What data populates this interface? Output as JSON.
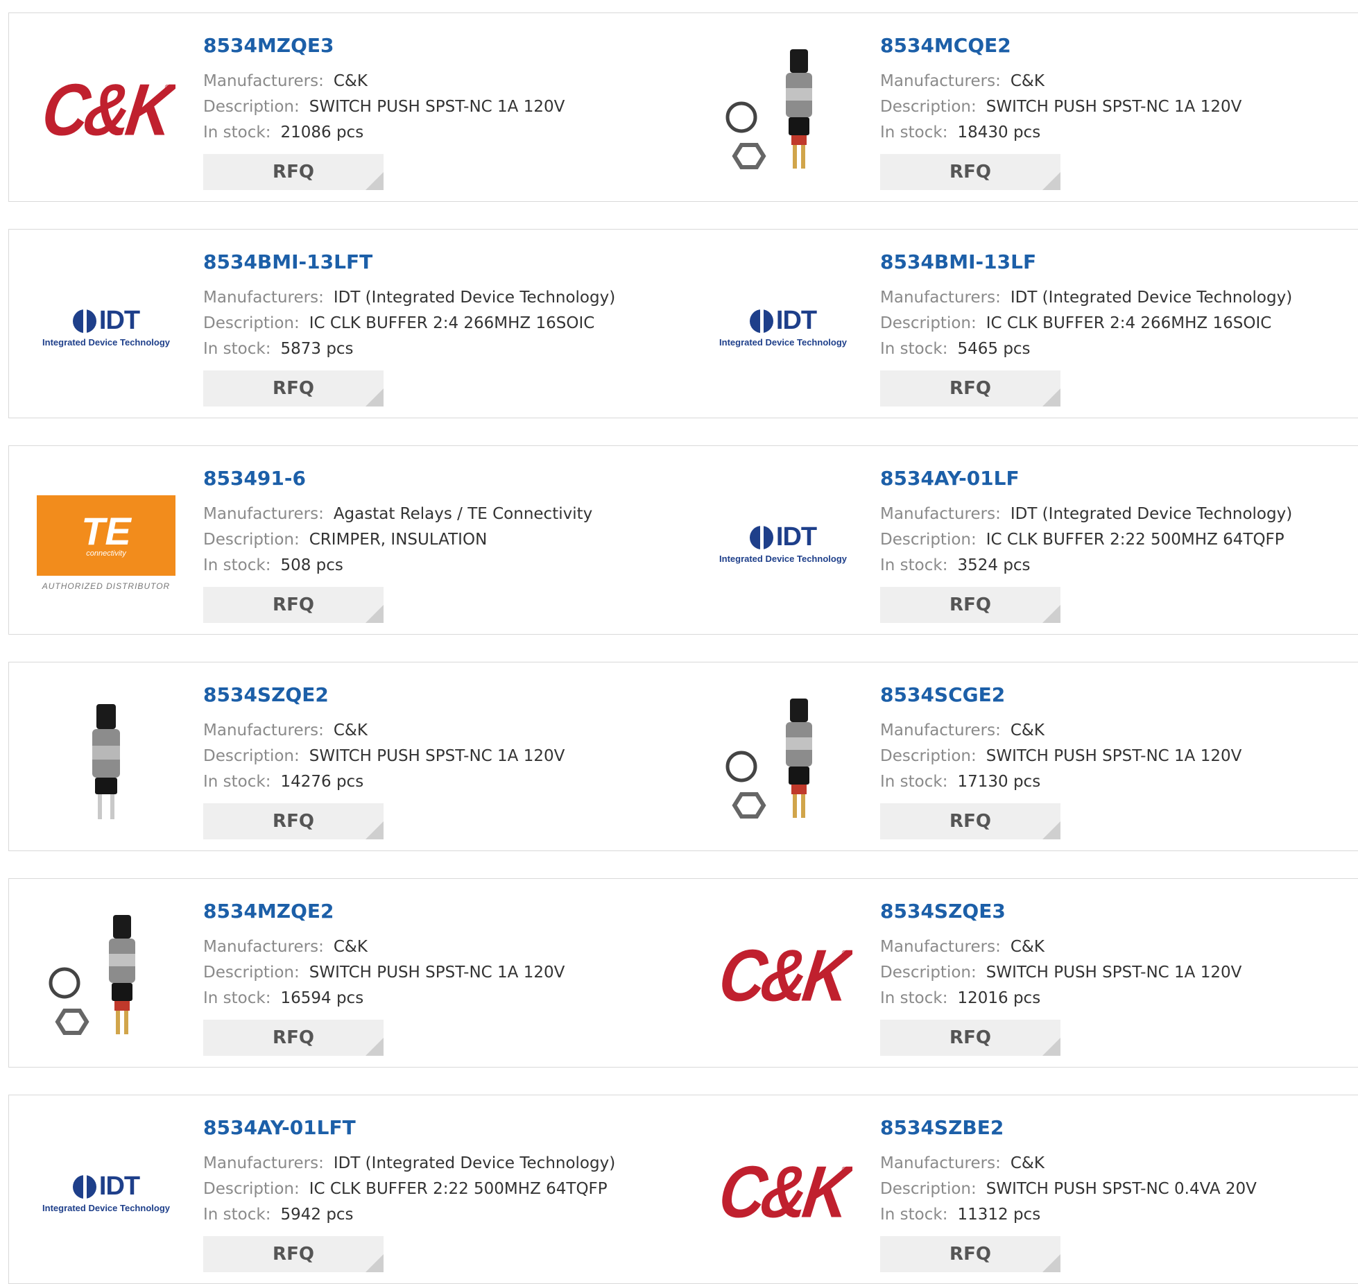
{
  "labels": {
    "manufacturers": "Manufacturers:",
    "description": "Description:",
    "in_stock": "In stock:",
    "rfq": "RFQ"
  },
  "logos": {
    "ck_text": "C&K",
    "ck_reg": "®",
    "idt_text": "IDT",
    "idt_sub": "Integrated Device Technology",
    "te_text": "TE",
    "te_sub": "connectivity",
    "te_auth": "AUTHORIZED DISTRIBUTOR"
  },
  "products": [
    {
      "part": "8534MZQE3",
      "manufacturer": "C&K",
      "description": "SWITCH PUSH SPST-NC 1A 120V",
      "stock": "21086 pcs",
      "image": "ck-logo"
    },
    {
      "part": "8534MCQE2",
      "manufacturer": "C&K",
      "description": "SWITCH PUSH SPST-NC 1A 120V",
      "stock": "18430 pcs",
      "image": "pushbutton-with-nuts-photo"
    },
    {
      "part": "8534BMI-13LFT",
      "manufacturer": "IDT (Integrated Device Technology)",
      "description": "IC CLK BUFFER 2:4 266MHZ 16SOIC",
      "stock": "5873 pcs",
      "image": "idt-logo"
    },
    {
      "part": "8534BMI-13LF",
      "manufacturer": "IDT (Integrated Device Technology)",
      "description": "IC CLK BUFFER 2:4 266MHZ 16SOIC",
      "stock": "5465 pcs",
      "image": "idt-logo"
    },
    {
      "part": "853491-6",
      "manufacturer": "Agastat Relays / TE Connectivity",
      "description": "CRIMPER, INSULATION",
      "stock": "508 pcs",
      "image": "te-logo"
    },
    {
      "part": "8534AY-01LF",
      "manufacturer": "IDT (Integrated Device Technology)",
      "description": "IC CLK BUFFER 2:22 500MHZ 64TQFP",
      "stock": "3524 pcs",
      "image": "idt-logo"
    },
    {
      "part": "8534SZQE2",
      "manufacturer": "C&K",
      "description": "SWITCH PUSH SPST-NC 1A 120V",
      "stock": "14276 pcs",
      "image": "pushbutton-photo"
    },
    {
      "part": "8534SCGE2",
      "manufacturer": "C&K",
      "description": "SWITCH PUSH SPST-NC 1A 120V",
      "stock": "17130 pcs",
      "image": "pushbutton-with-nuts-photo"
    },
    {
      "part": "8534MZQE2",
      "manufacturer": "C&K",
      "description": "SWITCH PUSH SPST-NC 1A 120V",
      "stock": "16594 pcs",
      "image": "pushbutton-with-nuts-photo"
    },
    {
      "part": "8534SZQE3",
      "manufacturer": "C&K",
      "description": "SWITCH PUSH SPST-NC 1A 120V",
      "stock": "12016 pcs",
      "image": "ck-logo"
    },
    {
      "part": "8534AY-01LFT",
      "manufacturer": "IDT (Integrated Device Technology)",
      "description": "IC CLK BUFFER 2:22 500MHZ 64TQFP",
      "stock": "5942 pcs",
      "image": "idt-logo"
    },
    {
      "part": "8534SZBE2",
      "manufacturer": "C&K",
      "description": "SWITCH PUSH SPST-NC 0.4VA 20V",
      "stock": "11312 pcs",
      "image": "ck-logo"
    }
  ],
  "colors": {
    "part_link": "#1c5fa8",
    "label": "#8a8a8a",
    "value": "#333333",
    "rfq_bg": "#efefef",
    "ck_red": "#c0202e",
    "idt_blue": "#1e3f8a",
    "te_orange": "#f28c1c"
  }
}
